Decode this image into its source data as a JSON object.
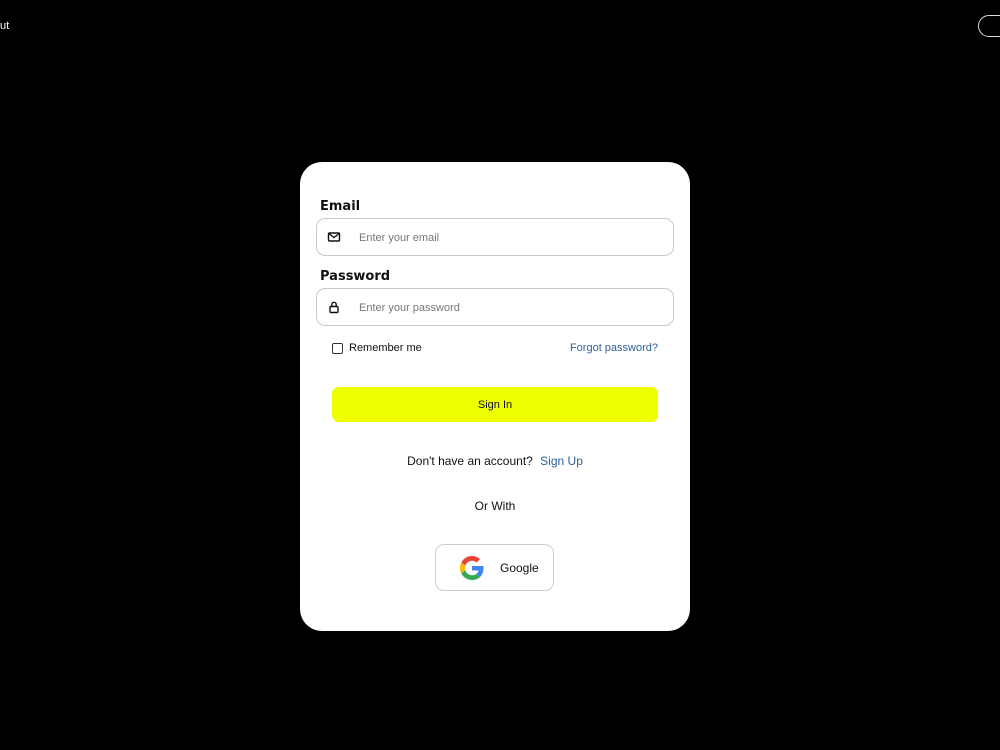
{
  "header": {
    "left_text": "ut"
  },
  "form": {
    "email_label": "Email",
    "email_placeholder": "Enter your email",
    "password_label": "Password",
    "password_placeholder": "Enter your password",
    "remember_label": "Remember me",
    "forgot_label": "Forgot password?",
    "signin_label": "Sign In",
    "no_account_text": "Don't have an account?",
    "signup_label": "Sign Up",
    "or_with_text": "Or With",
    "google_label": "Google"
  },
  "icons": {
    "email": "envelope-icon",
    "password": "lock-icon",
    "google": "google-icon"
  },
  "colors": {
    "background": "#000000",
    "card": "#ffffff",
    "accent": "#eeff00",
    "link": "#2d5f9a"
  }
}
